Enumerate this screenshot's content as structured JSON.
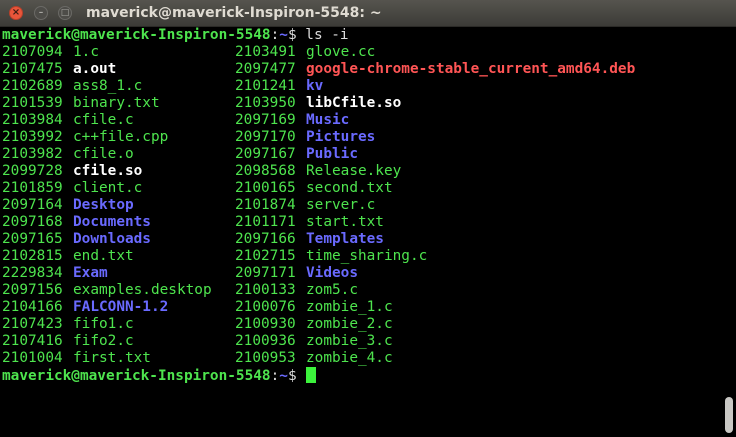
{
  "window": {
    "title": "maverick@maverick-Inspiron-5548: ~"
  },
  "colors": {
    "green": "#4ee44e",
    "blue": "#6a6aff",
    "red": "#ff5555",
    "white": "#ffffff"
  },
  "prompt": {
    "user_host": "maverick@maverick-Inspiron-5548",
    "sep": ":",
    "path": "~",
    "symbol": "$"
  },
  "command": "ls -i",
  "listing": [
    [
      {
        "inode": "2107094",
        "name": "1.c",
        "kind": "file"
      },
      {
        "inode": "2103491",
        "name": "glove.cc",
        "kind": "file"
      }
    ],
    [
      {
        "inode": "2107475",
        "name": "a.out",
        "kind": "exec"
      },
      {
        "inode": "2097477",
        "name": "google-chrome-stable_current_amd64.deb",
        "kind": "deb"
      }
    ],
    [
      {
        "inode": "2102689",
        "name": "ass8_1.c",
        "kind": "file"
      },
      {
        "inode": "2101241",
        "name": "kv",
        "kind": "dir"
      }
    ],
    [
      {
        "inode": "2101539",
        "name": "binary.txt",
        "kind": "file"
      },
      {
        "inode": "2103950",
        "name": "libCfile.so",
        "kind": "exec"
      }
    ],
    [
      {
        "inode": "2103984",
        "name": "cfile.c",
        "kind": "file"
      },
      {
        "inode": "2097169",
        "name": "Music",
        "kind": "dir"
      }
    ],
    [
      {
        "inode": "2103992",
        "name": "c++file.cpp",
        "kind": "file"
      },
      {
        "inode": "2097170",
        "name": "Pictures",
        "kind": "dir"
      }
    ],
    [
      {
        "inode": "2103982",
        "name": "cfile.o",
        "kind": "file"
      },
      {
        "inode": "2097167",
        "name": "Public",
        "kind": "dir"
      }
    ],
    [
      {
        "inode": "2099728",
        "name": "cfile.so",
        "kind": "exec"
      },
      {
        "inode": "2098568",
        "name": "Release.key",
        "kind": "file"
      }
    ],
    [
      {
        "inode": "2101859",
        "name": "client.c",
        "kind": "file"
      },
      {
        "inode": "2100165",
        "name": "second.txt",
        "kind": "file"
      }
    ],
    [
      {
        "inode": "2097164",
        "name": "Desktop",
        "kind": "dir"
      },
      {
        "inode": "2101874",
        "name": "server.c",
        "kind": "file"
      }
    ],
    [
      {
        "inode": "2097168",
        "name": "Documents",
        "kind": "dir"
      },
      {
        "inode": "2101171",
        "name": "start.txt",
        "kind": "file"
      }
    ],
    [
      {
        "inode": "2097165",
        "name": "Downloads",
        "kind": "dir"
      },
      {
        "inode": "2097166",
        "name": "Templates",
        "kind": "dir"
      }
    ],
    [
      {
        "inode": "2102815",
        "name": "end.txt",
        "kind": "file"
      },
      {
        "inode": "2102715",
        "name": "time_sharing.c",
        "kind": "file"
      }
    ],
    [
      {
        "inode": "2229834",
        "name": "Exam",
        "kind": "dir"
      },
      {
        "inode": "2097171",
        "name": "Videos",
        "kind": "dir"
      }
    ],
    [
      {
        "inode": "2097156",
        "name": "examples.desktop",
        "kind": "file"
      },
      {
        "inode": "2100133",
        "name": "zom5.c",
        "kind": "file"
      }
    ],
    [
      {
        "inode": "2104166",
        "name": "FALCONN-1.2",
        "kind": "dir"
      },
      {
        "inode": "2100076",
        "name": "zombie_1.c",
        "kind": "file"
      }
    ],
    [
      {
        "inode": "2107423",
        "name": "fifo1.c",
        "kind": "file"
      },
      {
        "inode": "2100930",
        "name": "zombie_2.c",
        "kind": "file"
      }
    ],
    [
      {
        "inode": "2107416",
        "name": "fifo2.c",
        "kind": "file"
      },
      {
        "inode": "2100936",
        "name": "zombie_3.c",
        "kind": "file"
      }
    ],
    [
      {
        "inode": "2101004",
        "name": "first.txt",
        "kind": "file"
      },
      {
        "inode": "2100953",
        "name": "zombie_4.c",
        "kind": "file"
      }
    ]
  ]
}
